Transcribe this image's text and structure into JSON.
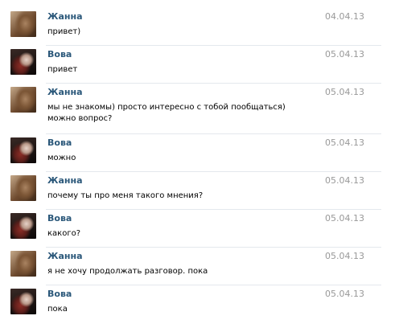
{
  "messages": [
    {
      "author": "Жанна",
      "date": "04.04.13",
      "text": "привет)",
      "avatar": "zhanna"
    },
    {
      "author": "Вова",
      "date": "05.04.13",
      "text": "привет",
      "avatar": "vova"
    },
    {
      "author": "Жанна",
      "date": "05.04.13",
      "text": "мы не знакомы) просто интересно с тобой пообщаться) можно вопрос?",
      "avatar": "zhanna"
    },
    {
      "author": "Вова",
      "date": "05.04.13",
      "text": "можно",
      "avatar": "vova"
    },
    {
      "author": "Жанна",
      "date": "05.04.13",
      "text": "почему ты про меня такого мнения?",
      "avatar": "zhanna"
    },
    {
      "author": "Вова",
      "date": "05.04.13",
      "text": "какого?",
      "avatar": "vova"
    },
    {
      "author": "Жанна",
      "date": "05.04.13",
      "text": "я не хочу продолжать разговор. пока",
      "avatar": "zhanna"
    },
    {
      "author": "Вова",
      "date": "05.04.13",
      "text": "пока",
      "avatar": "vova"
    }
  ]
}
